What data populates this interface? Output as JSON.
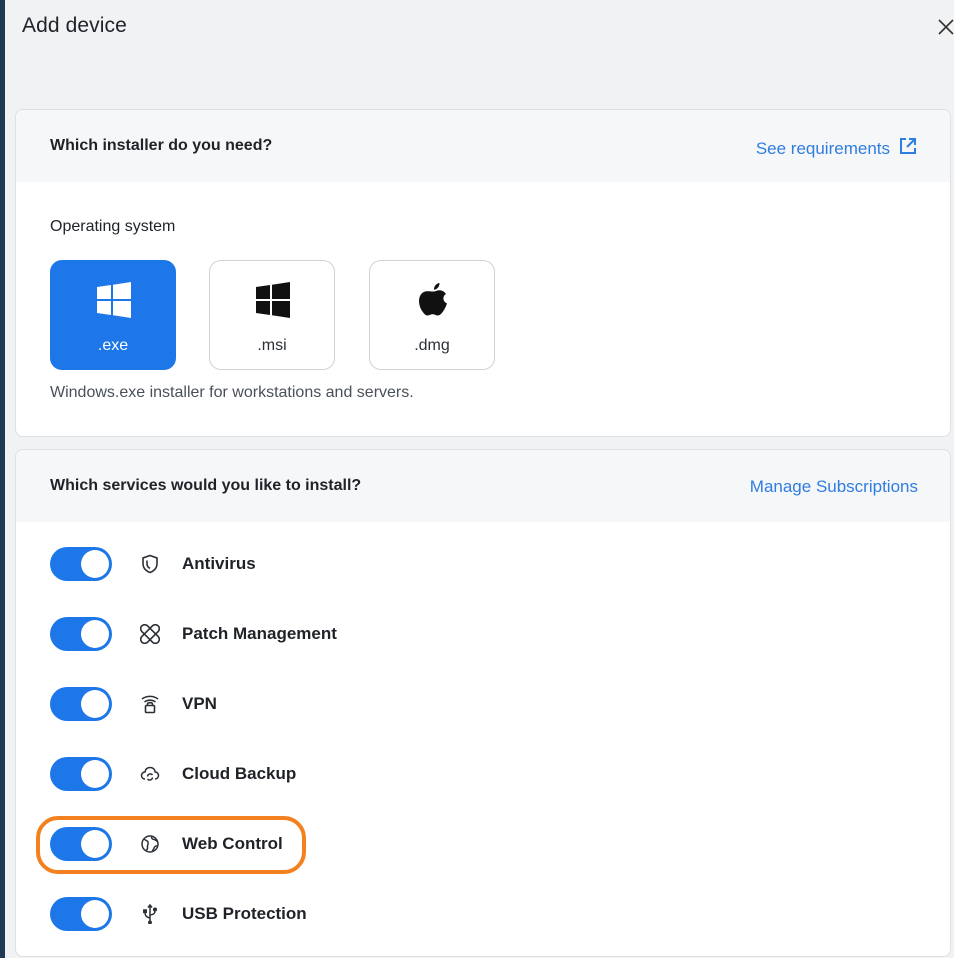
{
  "dialog": {
    "title": "Add device",
    "close_icon": "close-icon"
  },
  "installer": {
    "question": "Which installer do you need?",
    "requirements_link": "See requirements",
    "requirements_icon": "external-link-icon",
    "os_label": "Operating system",
    "options": [
      {
        "label": ".exe",
        "icon": "windows-icon",
        "selected": true
      },
      {
        "label": ".msi",
        "icon": "windows-icon",
        "selected": false
      },
      {
        "label": ".dmg",
        "icon": "apple-icon",
        "selected": false
      }
    ],
    "description": "Windows.exe installer for workstations and servers."
  },
  "services": {
    "question": "Which services would you like to install?",
    "manage_link": "Manage Subscriptions",
    "items": [
      {
        "label": "Antivirus",
        "icon": "shield-icon",
        "enabled": true
      },
      {
        "label": "Patch Management",
        "icon": "bandage-icon",
        "enabled": true
      },
      {
        "label": "VPN",
        "icon": "wifi-lock-icon",
        "enabled": true
      },
      {
        "label": "Cloud Backup",
        "icon": "cloud-sync-icon",
        "enabled": true
      },
      {
        "label": "Web Control",
        "icon": "globe-icon",
        "enabled": true,
        "highlighted": true
      },
      {
        "label": "USB Protection",
        "icon": "usb-icon",
        "enabled": true
      }
    ]
  },
  "colors": {
    "accent": "#1d77e8",
    "link": "#2f7de1",
    "highlight": "#f4811f"
  }
}
